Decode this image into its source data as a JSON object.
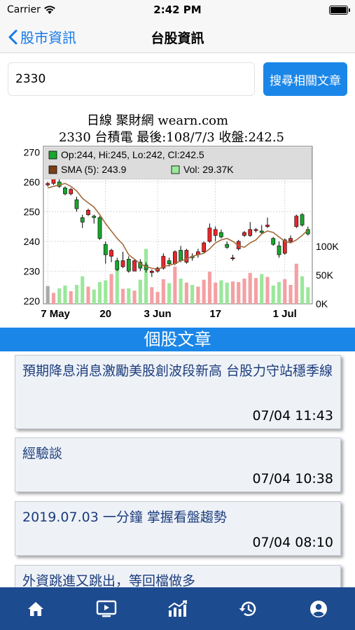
{
  "status_bar": {
    "carrier": "Carrier",
    "time": "2:42 PM",
    "icons": [
      "wifi-icon",
      "battery-icon"
    ]
  },
  "nav": {
    "back_label": "股市資訊",
    "title": "台股資訊"
  },
  "search": {
    "value": "2330",
    "button_label": "搜尋相關文章"
  },
  "chart": {
    "title": "日線 聚財網 wearn.com",
    "subtitle": "2330 台積電 最後:108/7/3 收盤:242.5",
    "legend": {
      "ohlc": "Op:244, Hi:245, Lo:242, Cl:242.5",
      "sma": "SMA (5): 243.9",
      "vol": "Vol: 29.37K"
    },
    "colors": {
      "up": "#e8272b",
      "down": "#1aa52e",
      "sma": "#a36a3c",
      "vol_up": "#f4a0a3",
      "vol_down": "#9ae89a",
      "grid": "#c8c8c8"
    }
  },
  "chart_data": {
    "type": "candlestick",
    "x_tick_labels": [
      "7 May",
      "20",
      "3 Jun",
      "17",
      "1 Jul"
    ],
    "y_ticks": [
      220,
      230,
      240,
      250,
      260,
      270
    ],
    "ylim": [
      219,
      272
    ],
    "volume_ticks": [
      "0K",
      "50K",
      "100K"
    ],
    "volume_lim": [
      0,
      110
    ],
    "grid": true,
    "sma_period": 5,
    "candles": [
      {
        "o": 259,
        "h": 260,
        "l": 258.5,
        "c": 259.5,
        "v": 31
      },
      {
        "o": 259.5,
        "h": 262.5,
        "l": 259,
        "c": 262,
        "v": 19
      },
      {
        "o": 260,
        "h": 261,
        "l": 258,
        "c": 258.5,
        "v": 27
      },
      {
        "o": 258,
        "h": 258.5,
        "l": 255.5,
        "c": 256,
        "v": 32
      },
      {
        "o": 256,
        "h": 258,
        "l": 255.5,
        "c": 257.5,
        "v": 22
      },
      {
        "o": 254,
        "h": 255,
        "l": 250,
        "c": 251,
        "v": 33
      },
      {
        "o": 248,
        "h": 249,
        "l": 244.5,
        "c": 246.5,
        "v": 48
      },
      {
        "o": 249,
        "h": 251,
        "l": 248.5,
        "c": 250.5,
        "v": 30
      },
      {
        "o": 248.5,
        "h": 249,
        "l": 246,
        "c": 248,
        "v": 25
      },
      {
        "o": 248,
        "h": 248.5,
        "l": 240.5,
        "c": 241,
        "v": 38
      },
      {
        "o": 239,
        "h": 240,
        "l": 232.5,
        "c": 235.5,
        "v": 41
      },
      {
        "o": 235,
        "h": 237.5,
        "l": 233,
        "c": 237,
        "v": 52
      },
      {
        "o": 233.5,
        "h": 234.5,
        "l": 230,
        "c": 230.5,
        "v": 66
      },
      {
        "o": 231.5,
        "h": 236.5,
        "l": 231,
        "c": 233.5,
        "v": 26
      },
      {
        "o": 234,
        "h": 235,
        "l": 229.5,
        "c": 230,
        "v": 27
      },
      {
        "o": 230,
        "h": 234,
        "l": 230,
        "c": 233.5,
        "v": 23
      },
      {
        "o": 233,
        "h": 234,
        "l": 230,
        "c": 231,
        "v": 42
      },
      {
        "o": 232,
        "h": 233,
        "l": 229.5,
        "c": 230.5,
        "v": 96
      },
      {
        "o": 229.5,
        "h": 230.5,
        "l": 228,
        "c": 230,
        "v": 29
      },
      {
        "o": 230,
        "h": 231.5,
        "l": 229.5,
        "c": 231,
        "v": 21
      },
      {
        "o": 231,
        "h": 236,
        "l": 230.5,
        "c": 235,
        "v": 43
      },
      {
        "o": 233.5,
        "h": 234.5,
        "l": 231.5,
        "c": 232.5,
        "v": 36
      },
      {
        "o": 232.5,
        "h": 237,
        "l": 232,
        "c": 236.5,
        "v": 65
      },
      {
        "o": 237,
        "h": 238.5,
        "l": 233,
        "c": 233.5,
        "v": 44
      },
      {
        "o": 233,
        "h": 237.5,
        "l": 232.5,
        "c": 237,
        "v": 37
      },
      {
        "o": 235,
        "h": 236,
        "l": 233.5,
        "c": 234.5,
        "v": 33
      },
      {
        "o": 235.5,
        "h": 237.5,
        "l": 234.5,
        "c": 236.5,
        "v": 30
      },
      {
        "o": 236.5,
        "h": 240,
        "l": 236,
        "c": 239.5,
        "v": 42
      },
      {
        "o": 240,
        "h": 246,
        "l": 239.5,
        "c": 244.5,
        "v": 56
      },
      {
        "o": 242,
        "h": 245,
        "l": 240,
        "c": 244,
        "v": 37
      },
      {
        "o": 243,
        "h": 244,
        "l": 241,
        "c": 241.5,
        "v": 41
      },
      {
        "o": 239,
        "h": 240,
        "l": 237.5,
        "c": 238,
        "v": 37
      },
      {
        "o": 234.5,
        "h": 235.5,
        "l": 233.5,
        "c": 234.5,
        "v": 39
      },
      {
        "o": 237.5,
        "h": 240.5,
        "l": 237,
        "c": 240,
        "v": 38
      },
      {
        "o": 242,
        "h": 243.5,
        "l": 241.5,
        "c": 243,
        "v": 44
      },
      {
        "o": 242,
        "h": 246.5,
        "l": 241.5,
        "c": 244,
        "v": 54
      },
      {
        "o": 244,
        "h": 244.5,
        "l": 243,
        "c": 244,
        "v": 45
      },
      {
        "o": 243.5,
        "h": 245.5,
        "l": 242.5,
        "c": 243,
        "v": 52
      },
      {
        "o": 245,
        "h": 248,
        "l": 244.5,
        "c": 245.5,
        "v": 47
      },
      {
        "o": 241,
        "h": 241.5,
        "l": 238.5,
        "c": 239,
        "v": 32
      },
      {
        "o": 238.5,
        "h": 240,
        "l": 234.5,
        "c": 235.5,
        "v": 38
      },
      {
        "o": 236,
        "h": 241,
        "l": 235.5,
        "c": 240.5,
        "v": 43
      },
      {
        "o": 240,
        "h": 242,
        "l": 239.5,
        "c": 241,
        "v": 33
      },
      {
        "o": 245,
        "h": 249,
        "l": 244.5,
        "c": 248.5,
        "v": 70
      },
      {
        "o": 249,
        "h": 249.5,
        "l": 245,
        "c": 245.5,
        "v": 48
      },
      {
        "o": 244,
        "h": 245,
        "l": 242,
        "c": 242.5,
        "v": 29
      }
    ],
    "sma": [
      258,
      258.5,
      259,
      259.5,
      258.5,
      257,
      254.5,
      253,
      251.5,
      249,
      246,
      243.5,
      241,
      239,
      235.5,
      234,
      232.5,
      231.5,
      231,
      230.5,
      231.5,
      232,
      232.5,
      233.5,
      234,
      235,
      235.5,
      236,
      237.5,
      239.5,
      240.5,
      241,
      240,
      238.5,
      238,
      239.5,
      240.5,
      242.5,
      243.5,
      243,
      241.5,
      240,
      239.5,
      240.5,
      242,
      243.9
    ]
  },
  "articles_section": {
    "title": "個股文章",
    "items": [
      {
        "title": "預期降息消息激勵美股創波段新高 台股力守站穩季線",
        "time": "07/04 11:43"
      },
      {
        "title": "經驗談",
        "time": "07/04 10:38"
      },
      {
        "title": "2019.07.03 一分鐘 掌握看盤趨勢",
        "time": "07/04 08:10"
      },
      {
        "title": "外資跳進又跳出，等回檔做多",
        "time": ""
      }
    ]
  },
  "tab_bar": {
    "tabs": [
      "home-icon",
      "video-icon",
      "chart-icon",
      "history-icon",
      "account-icon"
    ]
  }
}
